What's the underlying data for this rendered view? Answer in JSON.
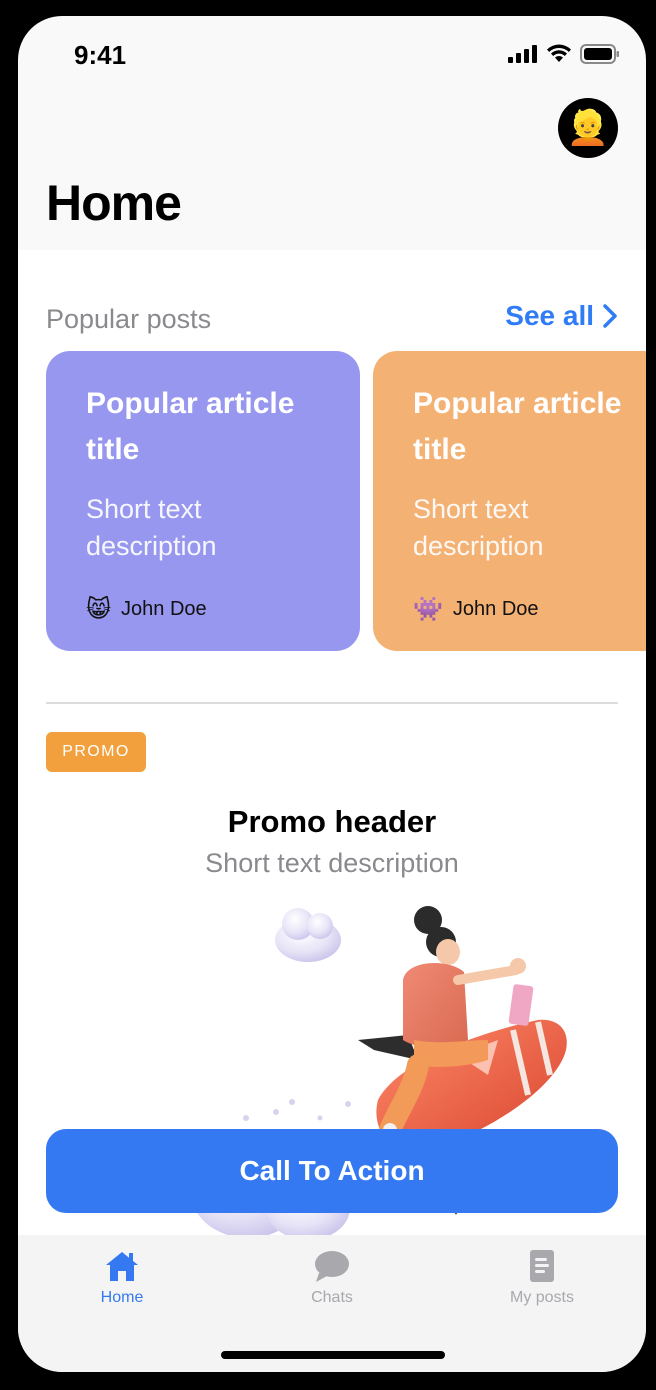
{
  "status": {
    "time": "9:41"
  },
  "header": {
    "title": "Home",
    "avatar": "👱"
  },
  "popular": {
    "title": "Popular posts",
    "see_all": "See all",
    "cards": [
      {
        "title": "Popular article title",
        "description": "Short text description",
        "author": "John Doe",
        "author_emoji": "😸",
        "color": "#9797ef"
      },
      {
        "title": "Popular article title",
        "description": "Short text description",
        "author": "John Doe",
        "author_emoji": "👾",
        "color": "#f3b174"
      }
    ]
  },
  "promo": {
    "badge": "PROMO",
    "header": "Promo header",
    "description": "Short text description"
  },
  "cta": {
    "label": "Call To Action"
  },
  "tabs": [
    {
      "label": "Home",
      "icon": "home-icon",
      "active": true
    },
    {
      "label": "Chats",
      "icon": "chat-bubble-icon",
      "active": false
    },
    {
      "label": "My posts",
      "icon": "document-icon",
      "active": false
    }
  ],
  "colors": {
    "accent": "#3479f2",
    "promo": "#f2a03d",
    "inactive": "#a8a8ad"
  }
}
